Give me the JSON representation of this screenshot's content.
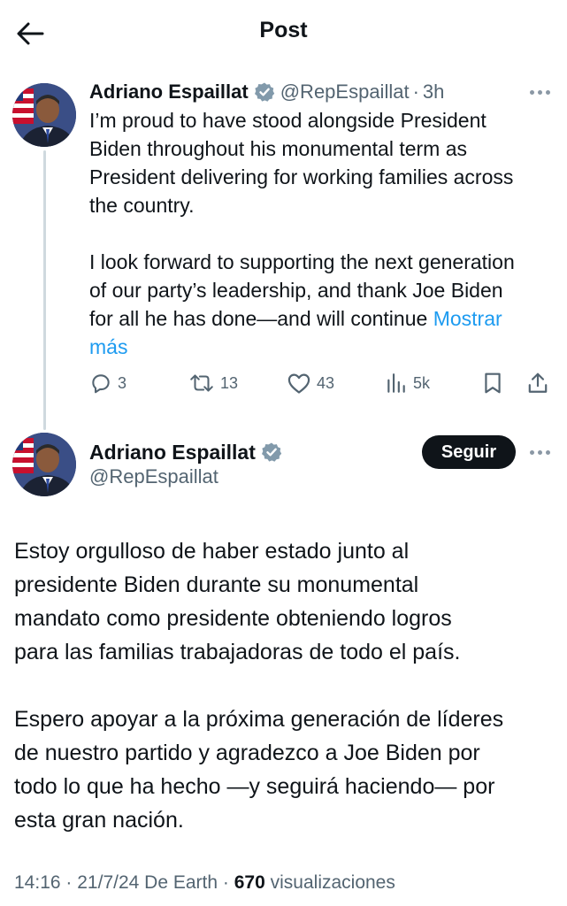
{
  "header": {
    "title": "Post",
    "back_icon": "arrow-left-icon"
  },
  "parent_tweet": {
    "author_name": "Adriano Espaillat",
    "handle": "@RepEspaillat",
    "separator": "·",
    "time": "3h",
    "paragraph1_lines": [
      "I’m proud to have stood alongside President",
      "Biden throughout his monumental term as",
      "President delivering for working families across",
      "the country."
    ],
    "paragraph2_lines": [
      "I look forward to supporting the next generation",
      "of our party’s leadership, and thank Joe Biden",
      "for all he has done—and will continue "
    ],
    "show_more_part1": "Mostrar",
    "show_more_part2": "más",
    "actions": {
      "replies": "3",
      "reposts": "13",
      "likes": "43",
      "views": "5k"
    }
  },
  "main_tweet": {
    "author_name": "Adriano Espaillat",
    "handle": "@RepEspaillat",
    "follow_label": "Seguir",
    "paragraph1_lines": [
      "Estoy orgulloso de haber estado junto al",
      "presidente Biden durante su monumental",
      "mandato como presidente obteniendo logros",
      "para las familias trabajadoras de todo el país."
    ],
    "paragraph2_lines": [
      "Espero apoyar a la próxima generación de líderes",
      "de nuestro partido y agradezco a Joe Biden por",
      "todo lo que ha hecho —y seguirá haciendo— por",
      "esta gran nación."
    ],
    "meta": {
      "time": "14:16",
      "date": "21/7/24",
      "source": "De Earth",
      "views_count": "670",
      "views_label": "visualizaciones",
      "separator": "·"
    }
  },
  "colors": {
    "text": "#0f1419",
    "secondary": "#536471",
    "link": "#1d9bf0",
    "verified": "#829aab",
    "follow_bg": "#0f1419",
    "thread_line": "#cfd9de"
  }
}
